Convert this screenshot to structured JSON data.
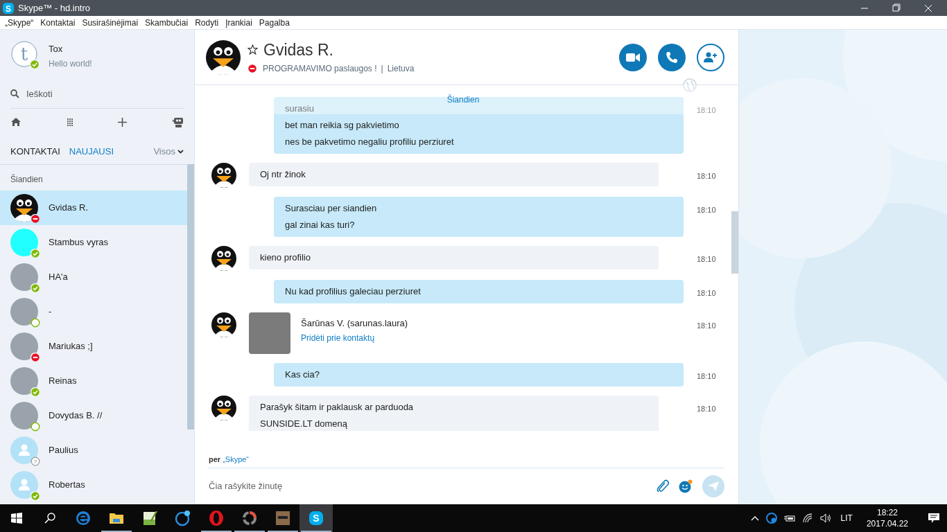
{
  "window": {
    "logo": "S",
    "title": "Skype™ - hd.intro"
  },
  "menu": [
    "„Skype“",
    "Kontaktai",
    "Susirašinėjimai",
    "Skambučiai",
    "Rodyti",
    "Įrankiai",
    "Pagalba"
  ],
  "profile": {
    "avatar_letter": "t",
    "name": "Tox",
    "mood": "Hello world!",
    "badge": {
      "kind": "online"
    }
  },
  "search": {
    "placeholder": "Ieškoti"
  },
  "tabs": [
    {
      "label": "KONTAKTAI",
      "selected": false
    },
    {
      "label": "NAUJAUSI",
      "selected": true
    }
  ],
  "filter": "Visos",
  "section": "Šiandien",
  "contacts": [
    {
      "name": "Gvidas R.",
      "badge": {
        "kind": "busy"
      },
      "kind": "penguin",
      "selected": true
    },
    {
      "name": "Stambus vyras",
      "badge": {
        "kind": "online"
      },
      "kind": "plain",
      "color": "#22ffff",
      "selected": false
    },
    {
      "name": "HA'a",
      "badge": {
        "kind": "online"
      },
      "kind": "photo",
      "selected": false
    },
    {
      "name": "-",
      "badge": {
        "kind": "offline"
      },
      "kind": "photo",
      "selected": false
    },
    {
      "name": "Mariukas ;]",
      "badge": {
        "kind": "busy"
      },
      "kind": "photo",
      "selected": false
    },
    {
      "name": "Reinas",
      "badge": {
        "kind": "online"
      },
      "kind": "photo",
      "selected": false
    },
    {
      "name": "Dovydas B. //",
      "badge": {
        "kind": "offline"
      },
      "kind": "photo",
      "selected": false
    },
    {
      "name": "Paulius",
      "badge": {
        "kind": "unknown",
        "label": "?"
      },
      "kind": "default",
      "selected": false
    },
    {
      "name": "Robertas",
      "badge": {
        "kind": "online"
      },
      "kind": "default",
      "selected": false
    }
  ],
  "chat": {
    "name": "Gvidas R.",
    "badge": {
      "kind": "busy"
    },
    "mood": "PROGRAMAVIMO paslaugos !",
    "separator": "|",
    "location": "Lietuva"
  },
  "date_label": "Šiandien",
  "messages": [
    {
      "kind": "out",
      "lines": [
        "surasiu",
        "bet man reikia sg pakvietimo",
        "nes be pakvetimo negaliu profiliu perziuret"
      ],
      "time": "18:10"
    },
    {
      "kind": "in",
      "lines": [
        "Oj ntr žinok"
      ],
      "time": "18:10"
    },
    {
      "kind": "out",
      "lines": [
        "Surasciau per siandien",
        "gal zinai kas turi?"
      ],
      "time": "18:10"
    },
    {
      "kind": "in",
      "lines": [
        "kieno profilio"
      ],
      "time": "18:10"
    },
    {
      "kind": "out",
      "lines": [
        "Nu kad profilius galeciau perziuret"
      ],
      "time": "18:10"
    },
    {
      "kind": "contact",
      "name": "Šarūnas V. (sarunas.laura)",
      "action": "Pridėti prie kontaktų",
      "time": "18:10"
    },
    {
      "kind": "out",
      "lines": [
        "Kas cia?"
      ],
      "time": "18:10"
    },
    {
      "kind": "in",
      "lines": [
        "Parašyk šitam ir paklausk ar parduoda",
        "SUNSIDE.LT domeną"
      ],
      "time": "18:10"
    }
  ],
  "footer": {
    "via": "per",
    "via_link": "„Skype“",
    "placeholder": "Čia rašykite žinutę"
  },
  "taskbar": {
    "apps": [
      {
        "kind": "edge",
        "running": false,
        "selected": false
      },
      {
        "kind": "folder",
        "running": true,
        "selected": false
      },
      {
        "kind": "notepad",
        "running": false,
        "selected": false
      },
      {
        "kind": "chat",
        "running": false,
        "selected": false
      },
      {
        "kind": "opera",
        "running": true,
        "selected": false
      },
      {
        "kind": "ring",
        "running": true,
        "selected": false
      },
      {
        "kind": "game",
        "running": true,
        "selected": false
      },
      {
        "kind": "skype",
        "label": "S",
        "running": true,
        "selected": true
      }
    ],
    "language": "LIT",
    "time": "18:22",
    "date": "2017.04.22"
  }
}
